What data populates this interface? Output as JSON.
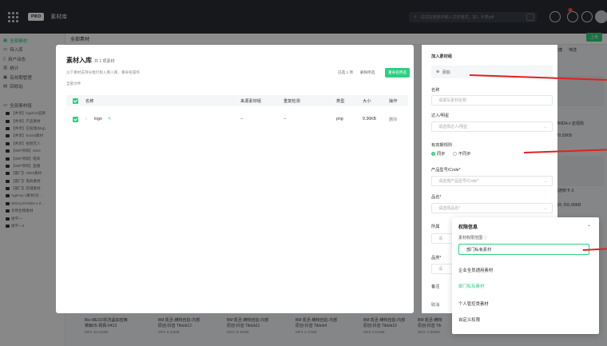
{
  "topbar": {
    "logo": "PIKO",
    "brand": "素材库",
    "search_placeholder": "试试在搜素中输入文件格式，如：手表pdf",
    "notif_count": "3"
  },
  "sidebar": {
    "nav": [
      "全部素材",
      "待入库",
      "用户动态",
      "统计",
      "有效期管理",
      "回收站"
    ],
    "section": "全部素材组",
    "tree": [
      "【共享】logo/VI/品牌",
      "【共享】产品素材",
      "【共享】已投放(bkg)",
      "【共享】Social素材",
      "【共享】视频艺人",
      "【WIP项目】SSO",
      "【WIP项目】电商",
      "【WIP项目】直播",
      "【部门】GDO素材",
      "【部门】电商素材",
      "【部门】店铺素材",
      "Agency-1素材(仅…",
      "SKULLPANDA x Z…",
      "华熙生物素材",
      "组平一",
      "组平一2"
    ]
  },
  "main": {
    "title": "全部素材",
    "upload": "上传",
    "right_tabs": [
      "快捷",
      "筛选"
    ],
    "right_items": [
      "PANDA x 亚视狗",
      "270.93KB",
      "倒游鲜卡-3",
      "图片 291.90KB"
    ]
  },
  "bottom_files": [
    {
      "name": "Bio-MESO机洗晶如密精\n菜鲸05-佩佩-0413",
      "meta": "MP4  19.41MB"
    },
    {
      "name": "BM 凯丞-横特自拍-内部\n原创-抖音 Tiktok12",
      "meta": "MP4  6.34MB"
    },
    {
      "name": "BM 凯丞-横特自拍-内部\n原创-抖音 Tiktok11",
      "meta": "MOV  6.46MB"
    },
    {
      "name": "BM 凯丞-横特自拍-内部\n原创-抖音 Tiktok4",
      "meta": "MP4  1.47MB"
    },
    {
      "name": "BM 凯丞-横特自拍-内部\n原创-抖音 Tiktok10",
      "meta": "MP4  4.51MB"
    },
    {
      "name": "BM 凯丞-横特\n原创-抖音 Tik",
      "meta": "MOV  4.96MB"
    },
    {
      "name": "BM 凯丞-横特自拍-内部\n原创-抖音 Tiktok",
      "meta": "MP4  3.73MB"
    },
    {
      "name": "BM 凯丞-横特自拍-内部\n原创-抖音 Tiktok",
      "meta": "MP4  7.3MB"
    }
  ],
  "modal": {
    "title": "素材入库",
    "count": "共 1 项素材",
    "hint": "以下素材支持分批打标入库入库，重命名操作",
    "all_files": "全部文件",
    "selected": "已选 1 项",
    "delete_selected": "删除所选",
    "rename_selected": "重命名所选",
    "columns": [
      "名称",
      "来源素材组",
      "重复检测",
      "类型",
      "大小",
      "操作"
    ],
    "row": {
      "name": "logo",
      "source": "--",
      "dup": "--",
      "type": "png",
      "size": "9.36KB",
      "action": "删除"
    }
  },
  "panel": {
    "add_group_label": "加入素材组",
    "add": "添加",
    "name_label": "名称",
    "name_placeholder": "请填写素材名称",
    "talent_label": "达人/明星",
    "talent_placeholder": "请选择达人/明星",
    "validity_label": "有效期规则",
    "sync": "同步",
    "nosync": "不同步",
    "product_label": "产品型号/Code*",
    "product_placeholder": "请选择产品型号/Code*",
    "category_label": "品名*",
    "category_placeholder": "请选择品名*",
    "belong_label": "所属",
    "belong_ph": "请",
    "grade_label": "品类*",
    "grade_ph": "请",
    "notes_label": "备注",
    "cancel": "取消"
  },
  "permission": {
    "title": "权限信息",
    "scope_label": "素材权限范围",
    "selected": "部门私有素材",
    "options": [
      "企业全员通用素材",
      "部门私有素材",
      "个人管控类素材",
      "自定义权限"
    ]
  },
  "colors": {
    "accent": "#2fcf7f",
    "annotation": "#d22222"
  }
}
